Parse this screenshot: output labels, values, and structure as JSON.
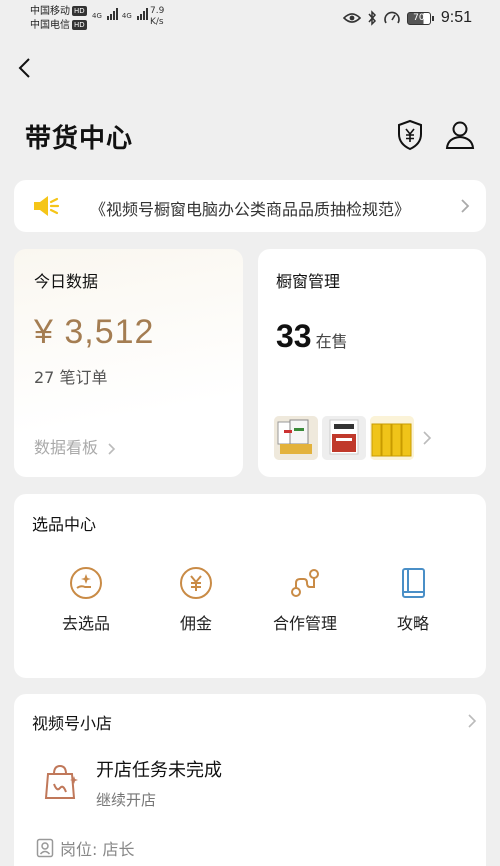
{
  "status_bar": {
    "carrier1": "中国移动",
    "carrier2": "中国电信",
    "hd_badge": "HD",
    "net1": "4G",
    "net2": "4G",
    "speed_value": "7.9",
    "speed_unit": "K/s",
    "battery": "70",
    "time": "9:51"
  },
  "header": {
    "title": "带货中心"
  },
  "notice": {
    "text": "《视频号橱窗电脑办公类商品品质抽检规范》"
  },
  "today": {
    "title": "今日数据",
    "amount": "¥ 3,512",
    "orders": "27 笔订单",
    "dashboard_link": "数据看板"
  },
  "showcase": {
    "title": "橱窗管理",
    "count": "33",
    "count_label": "在售"
  },
  "selection": {
    "title": "选品中心",
    "items": [
      {
        "label": "去选品",
        "icon": "pick-product-icon"
      },
      {
        "label": "佣金",
        "icon": "yen-coin-icon"
      },
      {
        "label": "合作管理",
        "icon": "cooperation-icon"
      },
      {
        "label": "攻略",
        "icon": "guide-book-icon"
      }
    ]
  },
  "shop": {
    "title": "视频号小店",
    "task_title": "开店任务未完成",
    "task_sub": "继续开店",
    "role": "岗位: 店长"
  },
  "colors": {
    "accent_gold": "#a47d52",
    "speaker_yellow": "#f5c518",
    "guide_blue": "#4a8fc7",
    "background": "#efefef"
  }
}
